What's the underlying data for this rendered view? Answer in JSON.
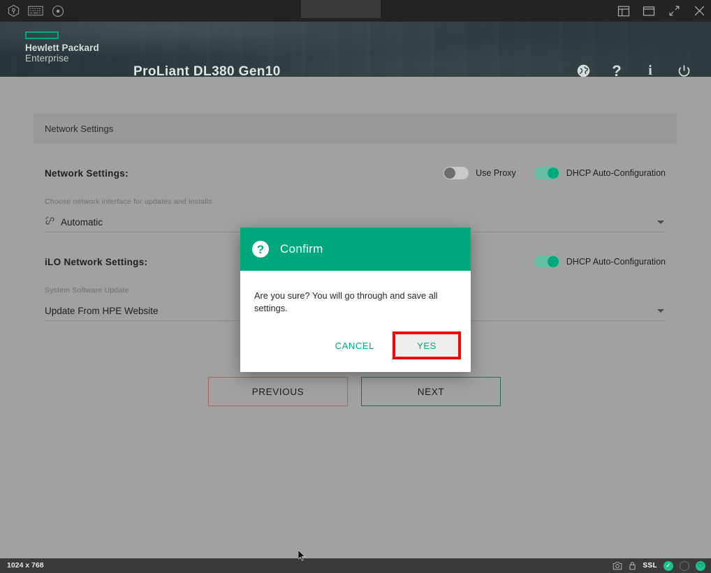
{
  "kvm_toolbar": {
    "left_icons": [
      {
        "name": "cube-shield-icon",
        "label": "Virtual Media / Host"
      },
      {
        "name": "keyboard-icon",
        "label": "Keyboard"
      },
      {
        "name": "disc-icon",
        "label": "Virtual Disc"
      }
    ],
    "right_icons": [
      {
        "name": "layout-panel-icon",
        "label": "Panel Layout"
      },
      {
        "name": "window-icon",
        "label": "Window Mode"
      },
      {
        "name": "fullscreen-icon",
        "label": "Full Screen"
      },
      {
        "name": "close-icon",
        "label": "Close"
      }
    ]
  },
  "header": {
    "brand_line1": "Hewlett Packard",
    "brand_line2": "Enterprise",
    "model": "ProLiant DL380 Gen10",
    "actions": [
      {
        "name": "language-globe-icon",
        "glyph": "♁",
        "label": "Language"
      },
      {
        "name": "help-icon",
        "glyph": "?",
        "label": "Help"
      },
      {
        "name": "info-icon",
        "glyph": "i",
        "label": "Information"
      },
      {
        "name": "power-icon",
        "glyph": "⏻",
        "label": "Power"
      }
    ]
  },
  "main": {
    "card_title": "Network Settings",
    "network_section": {
      "title": "Network Settings:",
      "use_proxy": {
        "label": "Use Proxy",
        "on": false
      },
      "dhcp": {
        "label": "DHCP Auto-Configuration",
        "on": true
      },
      "field_label": "Choose network interface for updates and installs",
      "field_value": "Automatic",
      "field_icon": "network-link-icon"
    },
    "ilo_section": {
      "title": "iLO Network Settings:",
      "dhcp": {
        "label": "DHCP Auto-Configuration",
        "on": true
      },
      "field_label": "System Software Update",
      "field_value": "Update From HPE Website"
    },
    "wizard": {
      "previous_label": "PREVIOUS",
      "next_label": "NEXT"
    }
  },
  "dialog": {
    "icon": "question-mark-icon",
    "icon_glyph": "?",
    "title": "Confirm",
    "message": "Are you sure? You will go through and save all settings.",
    "cancel_label": "CANCEL",
    "yes_label": "YES",
    "highlight_color": "#fb0007",
    "accent_color": "#00a97d"
  },
  "statusbar": {
    "resolution": "1024 x 768",
    "ssl_label": "SSL",
    "icons": [
      {
        "name": "camera-icon",
        "label": "Screen Capture"
      },
      {
        "name": "lock-icon",
        "label": "Secure Connection"
      }
    ],
    "indicators": [
      {
        "name": "status-ok-indicator",
        "state": "ok"
      },
      {
        "name": "status-idle-indicator",
        "state": "idle"
      },
      {
        "name": "status-power-indicator",
        "state": "on"
      }
    ]
  }
}
